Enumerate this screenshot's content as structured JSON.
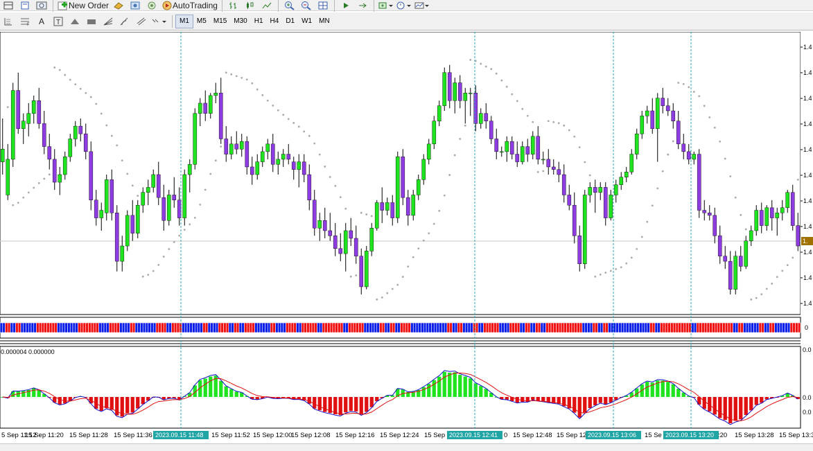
{
  "toolbar": {
    "new_order_label": "New Order",
    "autotrading_label": "AutoTrading",
    "timeframes": [
      "M1",
      "M5",
      "M15",
      "M30",
      "H1",
      "H4",
      "D1",
      "W1",
      "MN"
    ],
    "active_timeframe": "M1"
  },
  "indicator": {
    "scale_label": "0.000004 0.000000",
    "bar_scale_label": "0",
    "right_top": "0.0",
    "right_mid": "0.0",
    "right_low": "0.0"
  },
  "price_axis": {
    "labels": [
      "1.4",
      "1.4",
      "1.4",
      "1.4",
      "1.4",
      "1.4",
      "1.4",
      "1.4",
      "1.4",
      "1.4",
      "1.4"
    ],
    "current_price_label": "1."
  },
  "time_axis": {
    "labels": [
      "5 Sep 11:12",
      "15 Sep 11:20",
      "15 Sep 11:28",
      "15 Sep 11:36",
      "15 Sep 11:52",
      "15 Sep 12:00",
      "15 Sep 12:08",
      "15 Sep 12:16",
      "15 Sep 12:24",
      "15 Sep",
      "15 Sep 12:48",
      "15 Sep 12",
      "15 Se",
      "15 Sep 13:28",
      "15 Sep 13:3"
    ],
    "highlights": [
      "2023.09.15 11:48",
      "2023.09.15 12:41",
      "2023.09.15 13:06",
      "2023.09.15 13:20"
    ],
    "fragments": [
      "0",
      ":20"
    ]
  },
  "colors": {
    "bull": "#1ee31e",
    "bear": "#8c3ce0",
    "sar": "#a9a9a9",
    "blue_bar": "#0a1ee8",
    "red_bar": "#f01010",
    "signal_red": "#e01010",
    "signal_blue": "#1010c8",
    "marker": "#2aa9b6",
    "highlight_bg": "#20a5a5"
  },
  "chart_data": {
    "type": "candlestick",
    "candles": [
      [
        0.55,
        0.72,
        0.5,
        0.6
      ],
      [
        0.42,
        0.62,
        0.4,
        0.56
      ],
      [
        0.56,
        0.86,
        0.53,
        0.83
      ],
      [
        0.83,
        0.9,
        0.66,
        0.68
      ],
      [
        0.68,
        0.74,
        0.62,
        0.71
      ],
      [
        0.7,
        0.78,
        0.65,
        0.74
      ],
      [
        0.74,
        0.81,
        0.7,
        0.79
      ],
      [
        0.79,
        0.84,
        0.68,
        0.7
      ],
      [
        0.7,
        0.75,
        0.58,
        0.61
      ],
      [
        0.61,
        0.66,
        0.52,
        0.56
      ],
      [
        0.56,
        0.6,
        0.44,
        0.47
      ],
      [
        0.47,
        0.53,
        0.42,
        0.5
      ],
      [
        0.5,
        0.59,
        0.48,
        0.57
      ],
      [
        0.57,
        0.66,
        0.55,
        0.64
      ],
      [
        0.64,
        0.71,
        0.61,
        0.69
      ],
      [
        0.69,
        0.72,
        0.63,
        0.66
      ],
      [
        0.66,
        0.7,
        0.56,
        0.59
      ],
      [
        0.59,
        0.63,
        0.36,
        0.4
      ],
      [
        0.4,
        0.44,
        0.3,
        0.33
      ],
      [
        0.33,
        0.39,
        0.28,
        0.36
      ],
      [
        0.35,
        0.5,
        0.32,
        0.48
      ],
      [
        0.48,
        0.52,
        0.32,
        0.35
      ],
      [
        0.35,
        0.38,
        0.12,
        0.16
      ],
      [
        0.16,
        0.26,
        0.12,
        0.22
      ],
      [
        0.22,
        0.36,
        0.2,
        0.34
      ],
      [
        0.34,
        0.4,
        0.24,
        0.27
      ],
      [
        0.27,
        0.4,
        0.25,
        0.38
      ],
      [
        0.38,
        0.45,
        0.35,
        0.43
      ],
      [
        0.43,
        0.48,
        0.38,
        0.45
      ],
      [
        0.45,
        0.52,
        0.43,
        0.5
      ],
      [
        0.5,
        0.55,
        0.38,
        0.41
      ],
      [
        0.41,
        0.46,
        0.28,
        0.32
      ],
      [
        0.32,
        0.44,
        0.3,
        0.42
      ],
      [
        0.42,
        0.49,
        0.37,
        0.4
      ],
      [
        0.4,
        0.45,
        0.3,
        0.33
      ],
      [
        0.33,
        0.52,
        0.3,
        0.5
      ],
      [
        0.5,
        0.56,
        0.43,
        0.54
      ],
      [
        0.54,
        0.76,
        0.52,
        0.74
      ],
      [
        0.74,
        0.8,
        0.69,
        0.78
      ],
      [
        0.78,
        0.83,
        0.71,
        0.74
      ],
      [
        0.74,
        0.82,
        0.72,
        0.81
      ],
      [
        0.81,
        0.86,
        0.78,
        0.82
      ],
      [
        0.82,
        0.88,
        0.62,
        0.64
      ],
      [
        0.64,
        0.69,
        0.55,
        0.58
      ],
      [
        0.58,
        0.65,
        0.56,
        0.62
      ],
      [
        0.62,
        0.67,
        0.58,
        0.6
      ],
      [
        0.6,
        0.66,
        0.57,
        0.63
      ],
      [
        0.63,
        0.65,
        0.5,
        0.53
      ],
      [
        0.53,
        0.57,
        0.46,
        0.5
      ],
      [
        0.5,
        0.58,
        0.48,
        0.55
      ],
      [
        0.55,
        0.61,
        0.53,
        0.59
      ],
      [
        0.59,
        0.64,
        0.56,
        0.62
      ],
      [
        0.62,
        0.66,
        0.51,
        0.54
      ],
      [
        0.54,
        0.59,
        0.5,
        0.56
      ],
      [
        0.56,
        0.6,
        0.53,
        0.58
      ],
      [
        0.58,
        0.62,
        0.54,
        0.56
      ],
      [
        0.55,
        0.57,
        0.48,
        0.52
      ],
      [
        0.52,
        0.58,
        0.45,
        0.55
      ],
      [
        0.55,
        0.58,
        0.47,
        0.5
      ],
      [
        0.5,
        0.54,
        0.36,
        0.4
      ],
      [
        0.4,
        0.44,
        0.26,
        0.29
      ],
      [
        0.29,
        0.35,
        0.24,
        0.32
      ],
      [
        0.32,
        0.37,
        0.25,
        0.28
      ],
      [
        0.28,
        0.35,
        0.24,
        0.26
      ],
      [
        0.26,
        0.31,
        0.18,
        0.21
      ],
      [
        0.21,
        0.27,
        0.16,
        0.19
      ],
      [
        0.19,
        0.31,
        0.12,
        0.28
      ],
      [
        0.28,
        0.33,
        0.22,
        0.25
      ],
      [
        0.25,
        0.3,
        0.15,
        0.18
      ],
      [
        0.18,
        0.21,
        0.03,
        0.06
      ],
      [
        0.06,
        0.22,
        0.05,
        0.2
      ],
      [
        0.2,
        0.31,
        0.18,
        0.29
      ],
      [
        0.29,
        0.4,
        0.28,
        0.39
      ],
      [
        0.39,
        0.45,
        0.31,
        0.36
      ],
      [
        0.36,
        0.41,
        0.34,
        0.39
      ],
      [
        0.39,
        0.42,
        0.3,
        0.33
      ],
      [
        0.33,
        0.59,
        0.31,
        0.57
      ],
      [
        0.57,
        0.6,
        0.38,
        0.41
      ],
      [
        0.41,
        0.44,
        0.3,
        0.34
      ],
      [
        0.34,
        0.44,
        0.32,
        0.42
      ],
      [
        0.42,
        0.5,
        0.4,
        0.48
      ],
      [
        0.48,
        0.58,
        0.46,
        0.56
      ],
      [
        0.56,
        0.64,
        0.54,
        0.62
      ],
      [
        0.62,
        0.73,
        0.6,
        0.71
      ],
      [
        0.71,
        0.79,
        0.69,
        0.77
      ],
      [
        0.77,
        0.92,
        0.75,
        0.9
      ],
      [
        0.9,
        0.93,
        0.76,
        0.79
      ],
      [
        0.79,
        0.88,
        0.74,
        0.86
      ],
      [
        0.86,
        0.89,
        0.76,
        0.79
      ],
      [
        0.79,
        0.84,
        0.7,
        0.82
      ],
      [
        0.82,
        0.84,
        0.73,
        0.82
      ],
      [
        0.82,
        0.85,
        0.67,
        0.7
      ],
      [
        0.7,
        0.76,
        0.68,
        0.74
      ],
      [
        0.74,
        0.78,
        0.68,
        0.71
      ],
      [
        0.71,
        0.73,
        0.62,
        0.64
      ],
      [
        0.64,
        0.68,
        0.56,
        0.59
      ],
      [
        0.59,
        0.61,
        0.57,
        0.59
      ],
      [
        0.59,
        0.65,
        0.55,
        0.63
      ],
      [
        0.63,
        0.65,
        0.56,
        0.58
      ],
      [
        0.58,
        0.63,
        0.53,
        0.55
      ],
      [
        0.55,
        0.63,
        0.54,
        0.61
      ],
      [
        0.61,
        0.64,
        0.55,
        0.58
      ],
      [
        0.58,
        0.67,
        0.56,
        0.65
      ],
      [
        0.65,
        0.69,
        0.54,
        0.56
      ],
      [
        0.56,
        0.59,
        0.54,
        0.56
      ],
      [
        0.56,
        0.6,
        0.5,
        0.53
      ],
      [
        0.53,
        0.56,
        0.5,
        0.52
      ],
      [
        0.52,
        0.55,
        0.47,
        0.5
      ],
      [
        0.5,
        0.54,
        0.39,
        0.42
      ],
      [
        0.42,
        0.46,
        0.36,
        0.38
      ],
      [
        0.38,
        0.43,
        0.23,
        0.26
      ],
      [
        0.26,
        0.3,
        0.12,
        0.15
      ],
      [
        0.15,
        0.44,
        0.13,
        0.42
      ],
      [
        0.42,
        0.47,
        0.39,
        0.45
      ],
      [
        0.45,
        0.48,
        0.35,
        0.43
      ],
      [
        0.43,
        0.47,
        0.4,
        0.45
      ],
      [
        0.45,
        0.47,
        0.3,
        0.33
      ],
      [
        0.33,
        0.44,
        0.32,
        0.42
      ],
      [
        0.42,
        0.48,
        0.39,
        0.46
      ],
      [
        0.46,
        0.51,
        0.44,
        0.49
      ],
      [
        0.49,
        0.53,
        0.47,
        0.51
      ],
      [
        0.51,
        0.6,
        0.5,
        0.58
      ],
      [
        0.58,
        0.68,
        0.56,
        0.66
      ],
      [
        0.66,
        0.75,
        0.64,
        0.73
      ],
      [
        0.73,
        0.77,
        0.7,
        0.75
      ],
      [
        0.75,
        0.8,
        0.66,
        0.68
      ],
      [
        0.68,
        0.82,
        0.55,
        0.8
      ],
      [
        0.8,
        0.84,
        0.74,
        0.77
      ],
      [
        0.77,
        0.8,
        0.73,
        0.75
      ],
      [
        0.75,
        0.78,
        0.68,
        0.71
      ],
      [
        0.71,
        0.75,
        0.6,
        0.62
      ],
      [
        0.62,
        0.66,
        0.56,
        0.59
      ],
      [
        0.59,
        0.62,
        0.54,
        0.56
      ],
      [
        0.56,
        0.59,
        0.54,
        0.58
      ],
      [
        0.58,
        0.6,
        0.33,
        0.36
      ],
      [
        0.36,
        0.4,
        0.32,
        0.35
      ],
      [
        0.35,
        0.38,
        0.32,
        0.34
      ],
      [
        0.34,
        0.37,
        0.23,
        0.26
      ],
      [
        0.26,
        0.3,
        0.15,
        0.18
      ],
      [
        0.18,
        0.22,
        0.13,
        0.16
      ],
      [
        0.16,
        0.2,
        0.03,
        0.05
      ],
      [
        0.05,
        0.2,
        0.03,
        0.18
      ],
      [
        0.18,
        0.22,
        0.12,
        0.14
      ],
      [
        0.14,
        0.26,
        0.13,
        0.24
      ],
      [
        0.24,
        0.3,
        0.22,
        0.28
      ],
      [
        0.28,
        0.38,
        0.26,
        0.36
      ],
      [
        0.36,
        0.39,
        0.27,
        0.3
      ],
      [
        0.3,
        0.38,
        0.28,
        0.37
      ],
      [
        0.37,
        0.4,
        0.28,
        0.33
      ],
      [
        0.33,
        0.37,
        0.26,
        0.35
      ],
      [
        0.35,
        0.4,
        0.32,
        0.37
      ],
      [
        0.37,
        0.44,
        0.35,
        0.43
      ],
      [
        0.43,
        0.46,
        0.28,
        0.3
      ],
      [
        0.3,
        0.35,
        0.2,
        0.22
      ]
    ]
  }
}
